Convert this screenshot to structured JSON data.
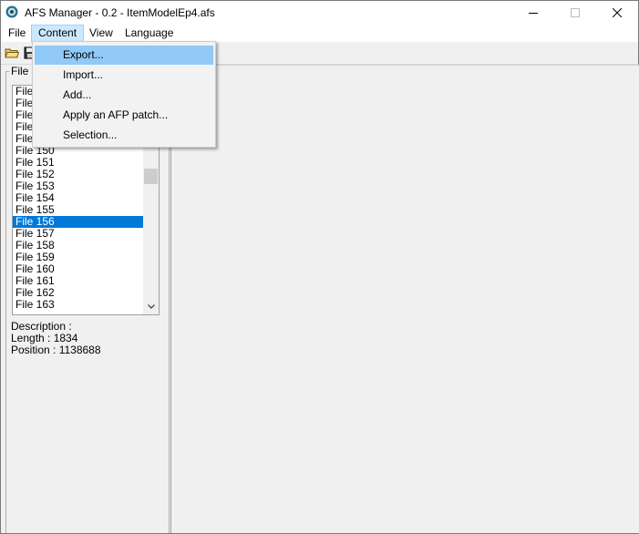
{
  "window": {
    "title": "AFS Manager - 0.2 - ItemModelEp4.afs",
    "minimize_glyph": "—",
    "maximize_glyph": "☐",
    "close_glyph": "✕"
  },
  "menubar": {
    "items": [
      {
        "label": "File"
      },
      {
        "label": "Content",
        "active": true
      },
      {
        "label": "View"
      },
      {
        "label": "Language"
      }
    ]
  },
  "content_menu": {
    "items": [
      {
        "label": "Export...",
        "highlighted": true
      },
      {
        "label": "Import..."
      },
      {
        "label": "Add..."
      },
      {
        "label": "Apply an AFP patch..."
      },
      {
        "label": "Selection..."
      }
    ]
  },
  "toolbar": {
    "icons": [
      "open-folder-icon",
      "save-icon"
    ]
  },
  "file_panel": {
    "group_label": "File c",
    "rows": [
      {
        "label": "File"
      },
      {
        "label": "File"
      },
      {
        "label": "File"
      },
      {
        "label": "File"
      },
      {
        "label": "File"
      },
      {
        "label": "File 150"
      },
      {
        "label": "File 151"
      },
      {
        "label": "File 152"
      },
      {
        "label": "File 153"
      },
      {
        "label": "File 154"
      },
      {
        "label": "File 155"
      },
      {
        "label": "File 156",
        "selected": true
      },
      {
        "label": "File 157"
      },
      {
        "label": "File 158"
      },
      {
        "label": "File 159"
      },
      {
        "label": "File 160"
      },
      {
        "label": "File 161"
      },
      {
        "label": "File 162"
      },
      {
        "label": "File 163"
      }
    ]
  },
  "info": {
    "description": "Description :",
    "length": "Length : 1834",
    "position": "Position : 1138688"
  },
  "colors": {
    "selection": "#0078d7",
    "menu_highlight": "#91c9f7",
    "menu_active": "#cce8ff"
  }
}
